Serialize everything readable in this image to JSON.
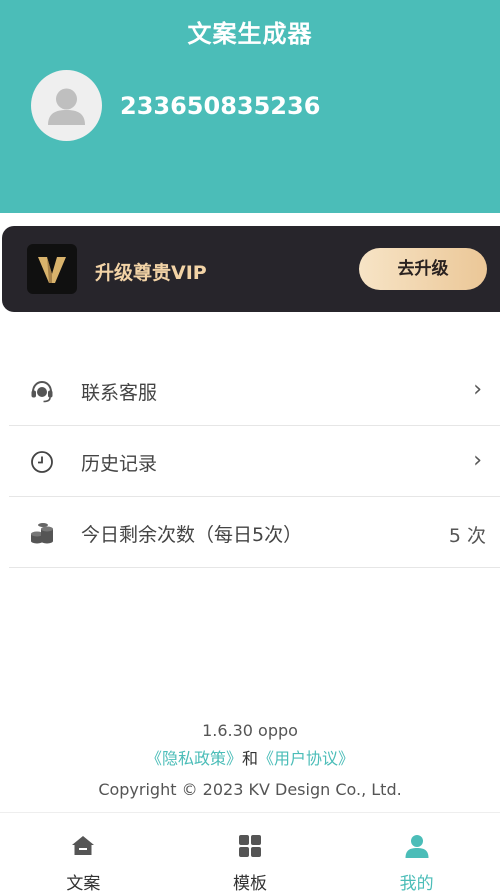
{
  "header": {
    "title": "文案生成器",
    "user_id": "233650835236",
    "background_color": "#4BBDB8"
  },
  "vip": {
    "logo_letter": "V",
    "text": "升级尊贵VIP",
    "button_label": "去升级"
  },
  "menu": {
    "items": [
      {
        "icon": "headset-icon",
        "label": "联系客服",
        "chevron": "›"
      },
      {
        "icon": "clock-icon",
        "label": "历史记录",
        "chevron": "›"
      },
      {
        "icon": "coins-icon",
        "label": "今日剩余次数（每日5次）",
        "value": "5 次"
      }
    ]
  },
  "footer": {
    "version": "1.6.30 oppo",
    "privacy_link": "《隐私政策》",
    "conjunction": "和",
    "agreement_link": "《用户协议》",
    "copyright": "Copyright © 2023 KV Design Co., Ltd."
  },
  "tabs": [
    {
      "icon": "home-icon",
      "label": "文案"
    },
    {
      "icon": "grid-icon",
      "label": "模板"
    },
    {
      "icon": "user-icon",
      "label": "我的",
      "active": true
    }
  ],
  "colors": {
    "accent": "#4BBDB8",
    "vip_card": "#27252B",
    "vip_text": "#F2D3A6"
  }
}
